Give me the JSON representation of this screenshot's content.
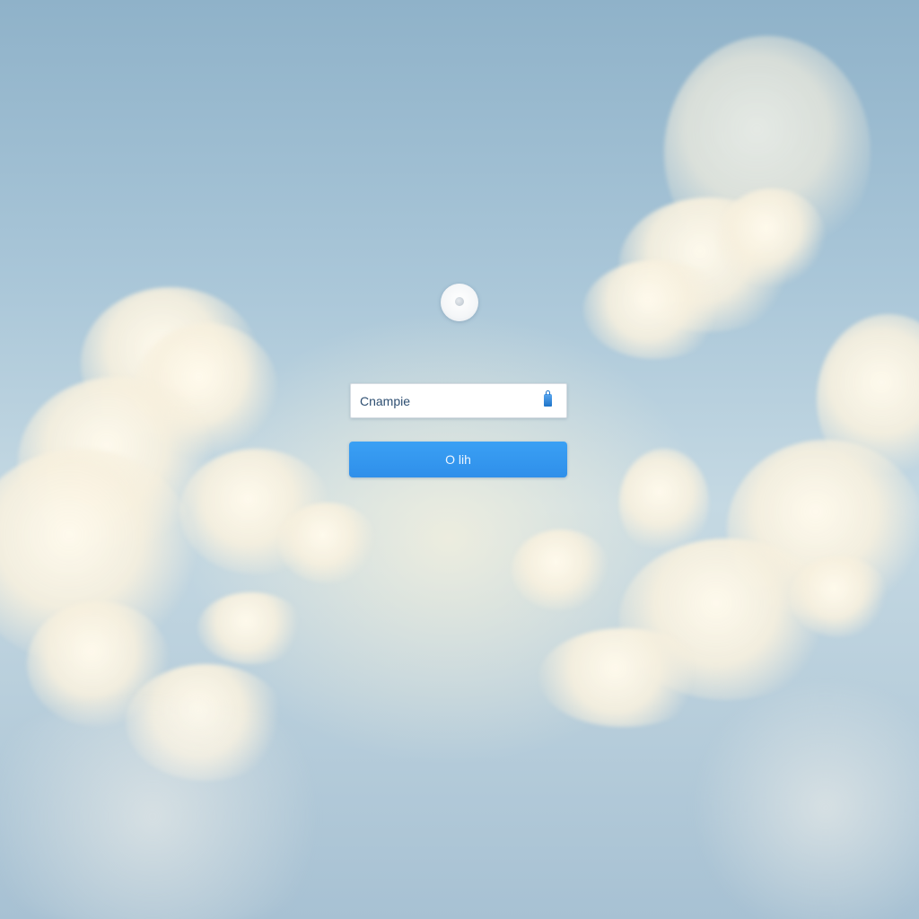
{
  "login": {
    "avatar_icon": "user-avatar-icon",
    "username_value": "Cnampie",
    "username_icon": "lock-icon",
    "submit_label": "O lih",
    "link_text": "",
    "colors": {
      "button": "#2f8fea",
      "field_text": "#2e4f72",
      "sky_top": "#8fb2c9",
      "cloud": "#fbf5e4"
    }
  }
}
